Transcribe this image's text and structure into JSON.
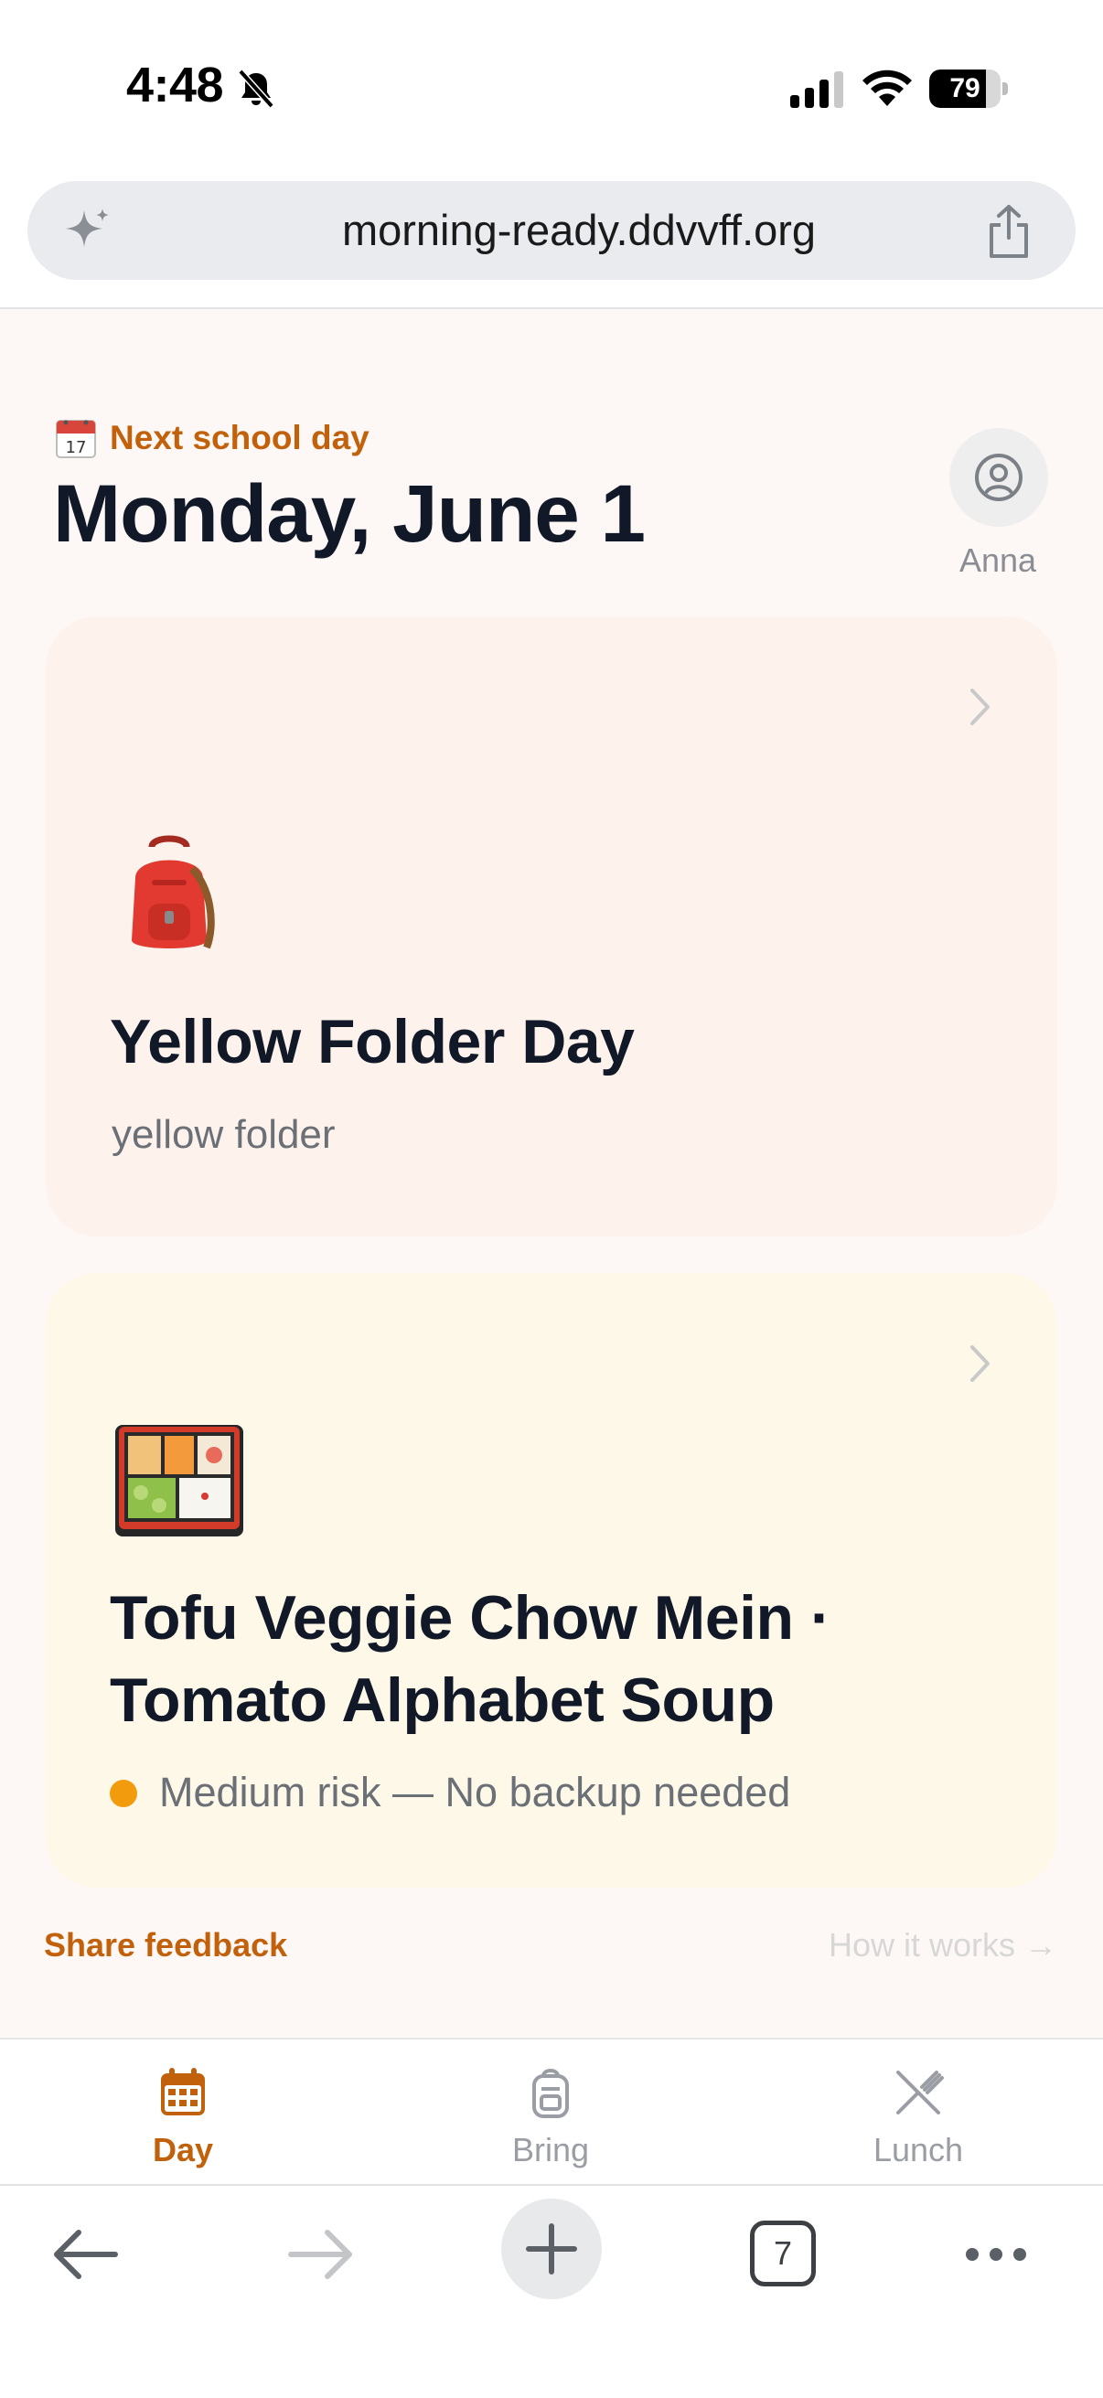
{
  "status_bar": {
    "time": "4:48",
    "battery_percent": "79",
    "battery_level": 0.79
  },
  "browser": {
    "url": "morning-ready.ddvvff.org",
    "tab_count": "7"
  },
  "header": {
    "next_day_label": "Next school day",
    "date_title": "Monday, June 1",
    "profile_name": "Anna"
  },
  "bring_card": {
    "title": "Yellow Folder Day",
    "subtitle": "yellow folder",
    "icon": "backpack-emoji"
  },
  "lunch_card": {
    "title": "Tofu Veggie Chow Mein · Tomato Alphabet Soup",
    "risk_text": "Medium risk — No backup needed",
    "risk_color": "#f29b0c",
    "icon": "bento-box-emoji"
  },
  "footer_links": {
    "share_feedback": "Share feedback",
    "how_it_works": "How it works →"
  },
  "tab_bar": {
    "active_color": "#c2610c",
    "inactive_color": "#9a9da3",
    "items": [
      {
        "label": "Day",
        "icon": "calendar-icon",
        "active": true
      },
      {
        "label": "Bring",
        "icon": "bag-icon",
        "active": false
      },
      {
        "label": "Lunch",
        "icon": "utensils-crossed-icon",
        "active": false
      }
    ]
  }
}
